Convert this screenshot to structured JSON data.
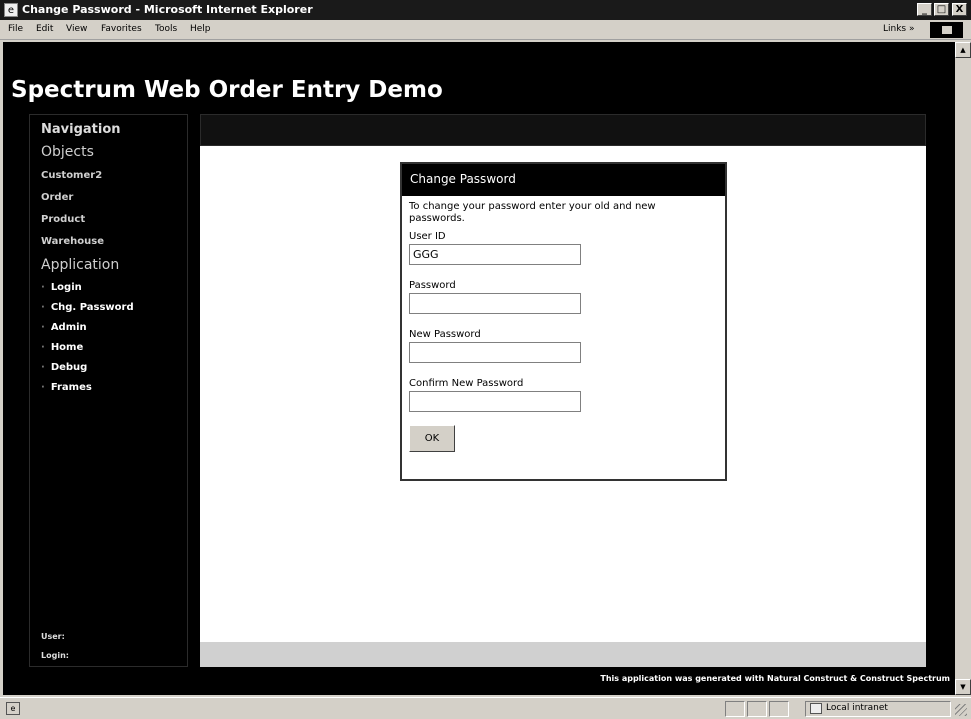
{
  "window": {
    "title": "Change Password - Microsoft Internet Explorer",
    "min_btn": "_",
    "max_btn": "□",
    "close_btn": "X"
  },
  "menubar": {
    "items": [
      "File",
      "Edit",
      "View",
      "Favorites",
      "Tools",
      "Help"
    ],
    "links_label": "Links »"
  },
  "page": {
    "title": "Spectrum Web Order Entry Demo"
  },
  "sidebar": {
    "navigation_label": "Navigation",
    "objects_label": "Objects",
    "objects": [
      "Customer2",
      "Order",
      "Product",
      "Warehouse"
    ],
    "application_label": "Application",
    "application_items": [
      "Login",
      "Chg. Password",
      "Admin",
      "Home",
      "Debug",
      "Frames"
    ],
    "bullet": "·",
    "user_label": "User:",
    "login_label": "Login:"
  },
  "dialog": {
    "title": "Change Password",
    "intro": "To change your password enter your old and new passwords.",
    "user_id_label": "User ID",
    "user_id_value": "GGG",
    "password_label": "Password",
    "new_password_label": "New Password",
    "confirm_password_label": "Confirm New Password",
    "ok_label": "OK"
  },
  "footer": {
    "text": "This application was generated with Natural Construct & Construct Spectrum"
  },
  "statusbar": {
    "zone": "Local intranet"
  },
  "icons": {
    "app": "ie-page-icon",
    "throbber": "windows-logo-icon",
    "status": "page-status-icon",
    "zone": "intranet-zone-icon"
  }
}
